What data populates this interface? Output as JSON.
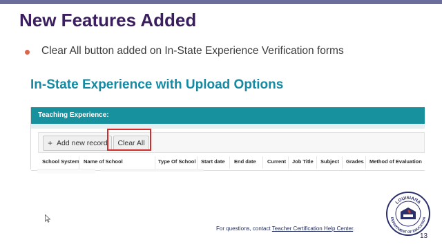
{
  "slide": {
    "title": "New Features Added",
    "bullet": "Clear All button added on In-State Experience Verification forms",
    "subtitle": "In-State Experience with Upload Options",
    "page_number": "13",
    "colors": {
      "title": "#3a1e5e",
      "subtitle": "#1689a3",
      "header": "#17919e",
      "bullet": "#d9654b",
      "highlight": "#d62b2b"
    }
  },
  "form": {
    "section_title": "Teaching Experience:",
    "add_button": "Add new record",
    "clear_button": "Clear All",
    "columns": [
      "School System",
      "Name of School",
      "Type Of School",
      "Start date",
      "End date",
      "Current",
      "Job Title",
      "Subject",
      "Grades",
      "Method of Evaluation"
    ]
  },
  "footer": {
    "text": "For questions, contact ",
    "link": "Teacher Certification Help Center",
    "end": "."
  },
  "logo": {
    "text_top": "LOUISIANA",
    "text_bottom": "DEPARTMENT OF EDUCATION"
  }
}
